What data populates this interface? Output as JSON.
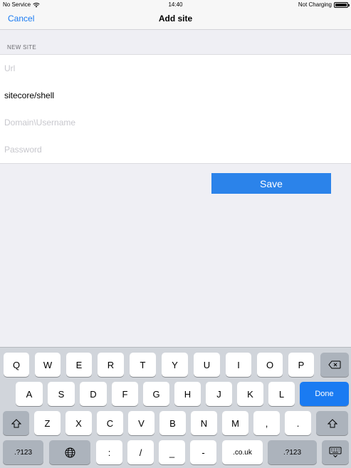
{
  "status_bar": {
    "carrier": "No Service",
    "time": "14:40",
    "battery_text": "Not Charging"
  },
  "nav": {
    "cancel_label": "Cancel",
    "title": "Add site"
  },
  "form": {
    "section_header": "NEW SITE",
    "url": {
      "value": "",
      "placeholder": "Url"
    },
    "site": {
      "value": "sitecore/shell",
      "placeholder": ""
    },
    "username": {
      "value": "",
      "placeholder": "Domain\\Username"
    },
    "password": {
      "value": "",
      "placeholder": "Password"
    },
    "save_label": "Save"
  },
  "keyboard": {
    "row1": [
      "Q",
      "W",
      "E",
      "R",
      "T",
      "Y",
      "U",
      "I",
      "O",
      "P"
    ],
    "row2": [
      "A",
      "S",
      "D",
      "F",
      "G",
      "H",
      "J",
      "K",
      "L"
    ],
    "done_label": "Done",
    "row3": [
      "Z",
      "X",
      "C",
      "V",
      "B",
      "N",
      "M",
      ",",
      "."
    ],
    "row4": {
      "numbers_left": ".?123",
      "colon": ":",
      "slash": "/",
      "underscore": "_",
      "dash": "-",
      "domain": ".co.uk",
      "numbers_right": ".?123"
    }
  },
  "colors": {
    "accent": "#1a7bf2",
    "save_button": "#2b83ea",
    "background": "#efeff4",
    "keyboard": "#d1d5db"
  }
}
